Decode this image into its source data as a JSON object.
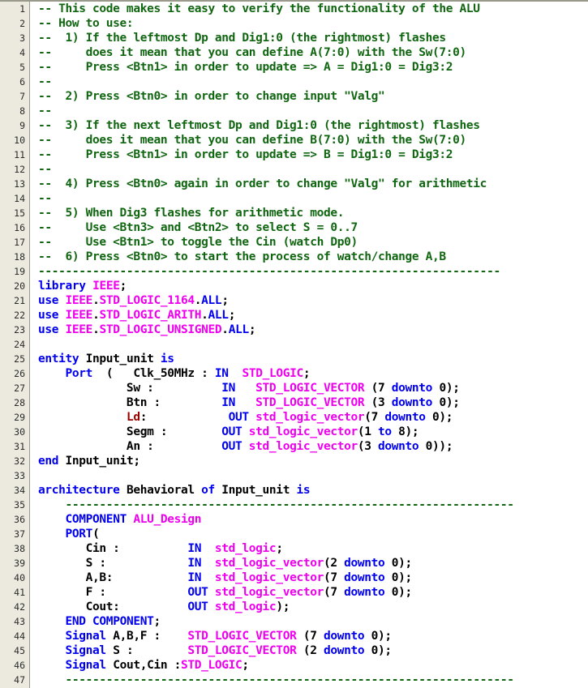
{
  "editor": {
    "language": "VHDL",
    "first_line": 1,
    "last_line": 47,
    "colors": {
      "background": "#ffffff",
      "gutter_background": "#eceadf",
      "gutter_border": "#9a9a8c",
      "comment": "#116611",
      "keyword": "#0000ee",
      "type": "#ee00ee",
      "identifier": "#000000",
      "error": "#990000"
    }
  },
  "lines": [
    {
      "n": 1,
      "tokens": [
        {
          "t": "cmt",
          "s": "-- This code makes it easy to verify the functionality of the ALU"
        }
      ]
    },
    {
      "n": 2,
      "tokens": [
        {
          "t": "cmt",
          "s": "-- How to use:"
        }
      ]
    },
    {
      "n": 3,
      "tokens": [
        {
          "t": "cmt",
          "s": "--  1) If the leftmost Dp and Dig1:0 (the rightmost) flashes"
        }
      ]
    },
    {
      "n": 4,
      "tokens": [
        {
          "t": "cmt",
          "s": "--     does it mean that you can define A(7:0) with the Sw(7:0)"
        }
      ]
    },
    {
      "n": 5,
      "tokens": [
        {
          "t": "cmt",
          "s": "--     Press <Btn1> in order to update => A = Dig1:0 = Dig3:2"
        }
      ]
    },
    {
      "n": 6,
      "tokens": [
        {
          "t": "cmt",
          "s": "--"
        }
      ]
    },
    {
      "n": 7,
      "tokens": [
        {
          "t": "cmt",
          "s": "--  2) Press <Btn0> in order to change input \"Valg\""
        }
      ]
    },
    {
      "n": 8,
      "tokens": [
        {
          "t": "cmt",
          "s": "--"
        }
      ]
    },
    {
      "n": 9,
      "tokens": [
        {
          "t": "cmt",
          "s": "--  3) If the next leftmost Dp and Dig1:0 (the rightmost) flashes"
        }
      ]
    },
    {
      "n": 10,
      "tokens": [
        {
          "t": "cmt",
          "s": "--     does it mean that you can define B(7:0) with the Sw(7:0)"
        }
      ]
    },
    {
      "n": 11,
      "tokens": [
        {
          "t": "cmt",
          "s": "--     Press <Btn1> in order to update => B = Dig1:0 = Dig3:2"
        }
      ]
    },
    {
      "n": 12,
      "tokens": [
        {
          "t": "cmt",
          "s": "--"
        }
      ]
    },
    {
      "n": 13,
      "tokens": [
        {
          "t": "cmt",
          "s": "--  4) Press <Btn0> again in order to change \"Valg\" for arithmetic"
        }
      ]
    },
    {
      "n": 14,
      "tokens": [
        {
          "t": "cmt",
          "s": "--"
        }
      ]
    },
    {
      "n": 15,
      "tokens": [
        {
          "t": "cmt",
          "s": "--  5) When Dig3 flashes for arithmetic mode."
        }
      ]
    },
    {
      "n": 16,
      "tokens": [
        {
          "t": "cmt",
          "s": "--     Use <Btn3> and <Btn2> to select S = 0..7"
        }
      ]
    },
    {
      "n": 17,
      "tokens": [
        {
          "t": "cmt",
          "s": "--     Use <Btn1> to toggle the Cin (watch Dp0)"
        }
      ]
    },
    {
      "n": 18,
      "tokens": [
        {
          "t": "cmt",
          "s": "--  6) Press <Btn0> to start the process of watch/change A,B"
        }
      ]
    },
    {
      "n": 19,
      "tokens": [
        {
          "t": "cmt",
          "s": "--------------------------------------------------------------------"
        }
      ]
    },
    {
      "n": 20,
      "tokens": [
        {
          "t": "kw",
          "s": "library"
        },
        {
          "t": "id",
          "s": " "
        },
        {
          "t": "type",
          "s": "IEEE"
        },
        {
          "t": "id",
          "s": ";"
        }
      ]
    },
    {
      "n": 21,
      "tokens": [
        {
          "t": "kw",
          "s": "use"
        },
        {
          "t": "id",
          "s": " "
        },
        {
          "t": "type",
          "s": "IEEE"
        },
        {
          "t": "id",
          "s": "."
        },
        {
          "t": "type",
          "s": "STD_LOGIC_1164"
        },
        {
          "t": "id",
          "s": "."
        },
        {
          "t": "kw",
          "s": "ALL"
        },
        {
          "t": "id",
          "s": ";"
        }
      ]
    },
    {
      "n": 22,
      "tokens": [
        {
          "t": "kw",
          "s": "use"
        },
        {
          "t": "id",
          "s": " "
        },
        {
          "t": "type",
          "s": "IEEE"
        },
        {
          "t": "id",
          "s": "."
        },
        {
          "t": "type",
          "s": "STD_LOGIC_ARITH"
        },
        {
          "t": "id",
          "s": "."
        },
        {
          "t": "kw",
          "s": "ALL"
        },
        {
          "t": "id",
          "s": ";"
        }
      ]
    },
    {
      "n": 23,
      "tokens": [
        {
          "t": "kw",
          "s": "use"
        },
        {
          "t": "id",
          "s": " "
        },
        {
          "t": "type",
          "s": "IEEE"
        },
        {
          "t": "id",
          "s": "."
        },
        {
          "t": "type",
          "s": "STD_LOGIC_UNSIGNED"
        },
        {
          "t": "id",
          "s": "."
        },
        {
          "t": "kw",
          "s": "ALL"
        },
        {
          "t": "id",
          "s": ";"
        }
      ]
    },
    {
      "n": 24,
      "tokens": []
    },
    {
      "n": 25,
      "tokens": [
        {
          "t": "kw",
          "s": "entity"
        },
        {
          "t": "id",
          "s": " Input_unit "
        },
        {
          "t": "kw",
          "s": "is"
        }
      ]
    },
    {
      "n": 26,
      "tokens": [
        {
          "t": "id",
          "s": "    "
        },
        {
          "t": "kw",
          "s": "Port"
        },
        {
          "t": "id",
          "s": "  (   Clk_50MHz : "
        },
        {
          "t": "kw",
          "s": "IN"
        },
        {
          "t": "id",
          "s": "  "
        },
        {
          "t": "type",
          "s": "STD_LOGIC"
        },
        {
          "t": "id",
          "s": ";"
        }
      ]
    },
    {
      "n": 27,
      "tokens": [
        {
          "t": "id",
          "s": "             Sw :          "
        },
        {
          "t": "kw",
          "s": "IN"
        },
        {
          "t": "id",
          "s": "   "
        },
        {
          "t": "type",
          "s": "STD_LOGIC_VECTOR"
        },
        {
          "t": "id",
          "s": " (7 "
        },
        {
          "t": "kw",
          "s": "downto"
        },
        {
          "t": "id",
          "s": " 0);"
        }
      ]
    },
    {
      "n": 28,
      "tokens": [
        {
          "t": "id",
          "s": "             Btn :         "
        },
        {
          "t": "kw",
          "s": "IN"
        },
        {
          "t": "id",
          "s": "   "
        },
        {
          "t": "type",
          "s": "STD_LOGIC_VECTOR"
        },
        {
          "t": "id",
          "s": " (3 "
        },
        {
          "t": "kw",
          "s": "downto"
        },
        {
          "t": "id",
          "s": " 0);"
        }
      ]
    },
    {
      "n": 29,
      "tokens": [
        {
          "t": "id",
          "s": "             "
        },
        {
          "t": "err",
          "s": "Ld"
        },
        {
          "t": "id",
          "s": ":            "
        },
        {
          "t": "kw",
          "s": "OUT"
        },
        {
          "t": "id",
          "s": " "
        },
        {
          "t": "type",
          "s": "std_logic_vector"
        },
        {
          "t": "id",
          "s": "(7 "
        },
        {
          "t": "kw",
          "s": "downto"
        },
        {
          "t": "id",
          "s": " 0);"
        }
      ]
    },
    {
      "n": 30,
      "tokens": [
        {
          "t": "id",
          "s": "             Segm :        "
        },
        {
          "t": "kw",
          "s": "OUT"
        },
        {
          "t": "id",
          "s": " "
        },
        {
          "t": "type",
          "s": "std_logic_vector"
        },
        {
          "t": "id",
          "s": "(1 "
        },
        {
          "t": "kw",
          "s": "to"
        },
        {
          "t": "id",
          "s": " 8);"
        }
      ]
    },
    {
      "n": 31,
      "tokens": [
        {
          "t": "id",
          "s": "             An :          "
        },
        {
          "t": "kw",
          "s": "OUT"
        },
        {
          "t": "id",
          "s": " "
        },
        {
          "t": "type",
          "s": "std_logic_vector"
        },
        {
          "t": "id",
          "s": "(3 "
        },
        {
          "t": "kw",
          "s": "downto"
        },
        {
          "t": "id",
          "s": " 0));"
        }
      ]
    },
    {
      "n": 32,
      "tokens": [
        {
          "t": "kw",
          "s": "end"
        },
        {
          "t": "id",
          "s": " Input_unit;"
        }
      ]
    },
    {
      "n": 33,
      "tokens": []
    },
    {
      "n": 34,
      "tokens": [
        {
          "t": "kw",
          "s": "architecture"
        },
        {
          "t": "id",
          "s": " Behavioral "
        },
        {
          "t": "kw",
          "s": "of"
        },
        {
          "t": "id",
          "s": " Input_unit "
        },
        {
          "t": "kw",
          "s": "is"
        }
      ]
    },
    {
      "n": 35,
      "tokens": [
        {
          "t": "id",
          "s": "    "
        },
        {
          "t": "cmt",
          "s": "------------------------------------------------------------------"
        }
      ]
    },
    {
      "n": 36,
      "tokens": [
        {
          "t": "id",
          "s": "    "
        },
        {
          "t": "kw",
          "s": "COMPONENT"
        },
        {
          "t": "id",
          "s": " "
        },
        {
          "t": "type",
          "s": "ALU_Design"
        }
      ]
    },
    {
      "n": 37,
      "tokens": [
        {
          "t": "id",
          "s": "    "
        },
        {
          "t": "kw",
          "s": "PORT"
        },
        {
          "t": "id",
          "s": "("
        }
      ]
    },
    {
      "n": 38,
      "tokens": [
        {
          "t": "id",
          "s": "       Cin :          "
        },
        {
          "t": "kw",
          "s": "IN"
        },
        {
          "t": "id",
          "s": "  "
        },
        {
          "t": "type",
          "s": "std_logic"
        },
        {
          "t": "id",
          "s": ";"
        }
      ]
    },
    {
      "n": 39,
      "tokens": [
        {
          "t": "id",
          "s": "       S :            "
        },
        {
          "t": "kw",
          "s": "IN"
        },
        {
          "t": "id",
          "s": "  "
        },
        {
          "t": "type",
          "s": "std_logic_vector"
        },
        {
          "t": "id",
          "s": "(2 "
        },
        {
          "t": "kw",
          "s": "downto"
        },
        {
          "t": "id",
          "s": " 0);"
        }
      ]
    },
    {
      "n": 40,
      "tokens": [
        {
          "t": "id",
          "s": "       A,B:           "
        },
        {
          "t": "kw",
          "s": "IN"
        },
        {
          "t": "id",
          "s": "  "
        },
        {
          "t": "type",
          "s": "std_logic_vector"
        },
        {
          "t": "id",
          "s": "(7 "
        },
        {
          "t": "kw",
          "s": "downto"
        },
        {
          "t": "id",
          "s": " 0);"
        }
      ]
    },
    {
      "n": 41,
      "tokens": [
        {
          "t": "id",
          "s": "       F :            "
        },
        {
          "t": "kw",
          "s": "OUT"
        },
        {
          "t": "id",
          "s": " "
        },
        {
          "t": "type",
          "s": "std_logic_vector"
        },
        {
          "t": "id",
          "s": "(7 "
        },
        {
          "t": "kw",
          "s": "downto"
        },
        {
          "t": "id",
          "s": " 0);"
        }
      ]
    },
    {
      "n": 42,
      "tokens": [
        {
          "t": "id",
          "s": "       Cout:          "
        },
        {
          "t": "kw",
          "s": "OUT"
        },
        {
          "t": "id",
          "s": " "
        },
        {
          "t": "type",
          "s": "std_logic"
        },
        {
          "t": "id",
          "s": ");"
        }
      ]
    },
    {
      "n": 43,
      "tokens": [
        {
          "t": "id",
          "s": "    "
        },
        {
          "t": "kw",
          "s": "END COMPONENT"
        },
        {
          "t": "id",
          "s": ";"
        }
      ]
    },
    {
      "n": 44,
      "tokens": [
        {
          "t": "id",
          "s": "    "
        },
        {
          "t": "kw",
          "s": "Signal"
        },
        {
          "t": "id",
          "s": " A,B,F :    "
        },
        {
          "t": "type",
          "s": "STD_LOGIC_VECTOR"
        },
        {
          "t": "id",
          "s": " (7 "
        },
        {
          "t": "kw",
          "s": "downto"
        },
        {
          "t": "id",
          "s": " 0);"
        }
      ]
    },
    {
      "n": 45,
      "tokens": [
        {
          "t": "id",
          "s": "    "
        },
        {
          "t": "kw",
          "s": "Signal"
        },
        {
          "t": "id",
          "s": " S :        "
        },
        {
          "t": "type",
          "s": "STD_LOGIC_VECTOR"
        },
        {
          "t": "id",
          "s": " (2 "
        },
        {
          "t": "kw",
          "s": "downto"
        },
        {
          "t": "id",
          "s": " 0);"
        }
      ]
    },
    {
      "n": 46,
      "tokens": [
        {
          "t": "id",
          "s": "    "
        },
        {
          "t": "kw",
          "s": "Signal"
        },
        {
          "t": "id",
          "s": " Cout,Cin :"
        },
        {
          "t": "type",
          "s": "STD_LOGIC"
        },
        {
          "t": "id",
          "s": ";"
        }
      ]
    },
    {
      "n": 47,
      "tokens": [
        {
          "t": "id",
          "s": "    "
        },
        {
          "t": "cmt",
          "s": "------------------------------------------------------------------"
        }
      ]
    }
  ]
}
